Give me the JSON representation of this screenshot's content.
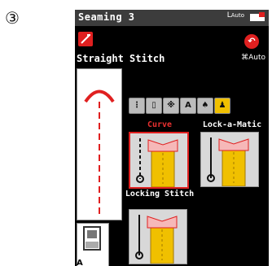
{
  "step_marker": "③",
  "header": {
    "title": "Seaming 3",
    "auto_label": "Auto",
    "presser_icon": "presser-foot-icon"
  },
  "stitch": {
    "name": "Straight Stitch",
    "icon": "straight-stitch-icon",
    "auto_label": "Auto"
  },
  "controls": {
    "back_icon": "back-arrow-icon"
  },
  "categories": [
    {
      "icon": "zigzag-icon",
      "selected": false
    },
    {
      "icon": "buttonhole-icon",
      "selected": false
    },
    {
      "icon": "decorative-icon",
      "selected": false
    },
    {
      "icon": "letter-a-icon",
      "label": "A",
      "selected": false
    },
    {
      "icon": "quilt-icon",
      "selected": false
    },
    {
      "icon": "shirt-icon",
      "selected": true
    }
  ],
  "options": [
    {
      "label": "Curve",
      "selected": true
    },
    {
      "label": "Lock-a-Matic",
      "selected": false
    },
    {
      "label": "Locking Stitch",
      "selected": false
    }
  ],
  "foot": {
    "letter": "A"
  },
  "colors": {
    "accent_red": "#e02020",
    "selected_yellow": "#f0c000",
    "background": "#000000"
  }
}
